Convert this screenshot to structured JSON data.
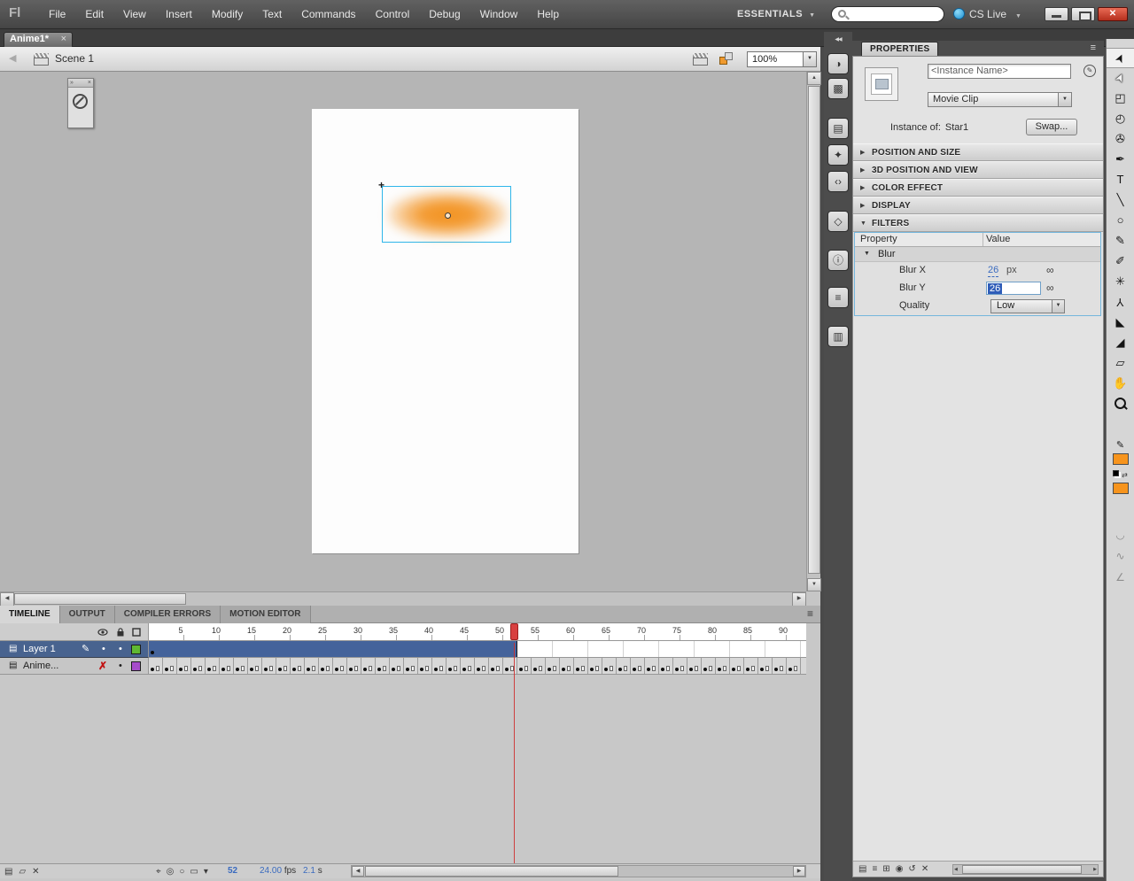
{
  "app": {
    "logo": "Fl"
  },
  "menubar": {
    "items": [
      "File",
      "Edit",
      "View",
      "Insert",
      "Modify",
      "Text",
      "Commands",
      "Control",
      "Debug",
      "Window",
      "Help"
    ],
    "workspace": "ESSENTIALS",
    "cs_live": "CS Live",
    "search_value": ""
  },
  "icons": {
    "close": "✕",
    "close_small": "×",
    "up": "▲",
    "down": "▼",
    "left": "◀",
    "right": "▶",
    "tri_right": "▶",
    "menu": "≡",
    "collapse_left": "◀◀",
    "chevrons_right": "»",
    "pencil": "✎",
    "dot": "•",
    "hidden_x": "✗",
    "crosshair": "+",
    "link": "∞",
    "swap_colors": "⇄",
    "layer": "▤"
  },
  "doc_tab": {
    "title": "Anime1*",
    "close_glyph": "×"
  },
  "edit_bar": {
    "scene_label": "Scene 1",
    "zoom_value": "100%"
  },
  "dock_icons": [
    {
      "name": "color",
      "glyph": "◑"
    },
    {
      "name": "swatches",
      "glyph": "▩"
    },
    {
      "name": "components",
      "glyph": "▤"
    },
    {
      "name": "motion-presets",
      "glyph": "✦"
    },
    {
      "name": "code-snippets",
      "glyph": "‹›"
    },
    {
      "name": "transform",
      "glyph": "◇"
    },
    {
      "name": "info",
      "glyph": "ⓘ"
    },
    {
      "name": "align",
      "glyph": "≡"
    },
    {
      "name": "library",
      "glyph": "▥"
    }
  ],
  "properties": {
    "tab": "PROPERTIES",
    "instance_name_placeholder": "<Instance Name>",
    "symbol_type": "Movie Clip",
    "instance_of_label": "Instance of:",
    "instance_of_value": "Star1",
    "swap_label": "Swap...",
    "sections": [
      {
        "label": "POSITION AND SIZE",
        "expanded": false
      },
      {
        "label": "3D POSITION AND VIEW",
        "expanded": false
      },
      {
        "label": "COLOR EFFECT",
        "expanded": false
      },
      {
        "label": "DISPLAY",
        "expanded": false
      },
      {
        "label": "FILTERS",
        "expanded": true
      }
    ],
    "filters": {
      "property_header": "Property",
      "value_header": "Value",
      "group_label": "Blur",
      "blur_x_label": "Blur X",
      "blur_x_value": "26",
      "blur_x_unit": "px",
      "blur_y_label": "Blur Y",
      "blur_y_value": "26",
      "quality_label": "Quality",
      "quality_value": "Low"
    },
    "filter_bar_icons": [
      {
        "name": "add-filter",
        "glyph": "▤"
      },
      {
        "name": "presets",
        "glyph": "≡"
      },
      {
        "name": "clipboard",
        "glyph": "⊞"
      },
      {
        "name": "enable-filter",
        "glyph": "◉"
      },
      {
        "name": "reset-filter",
        "glyph": "↺"
      },
      {
        "name": "delete-filter",
        "glyph": "✕"
      }
    ]
  },
  "timeline": {
    "tabs": [
      {
        "label": "TIMELINE",
        "active": true
      },
      {
        "label": "OUTPUT",
        "active": false
      },
      {
        "label": "COMPILER ERRORS",
        "active": false
      },
      {
        "label": "MOTION EDITOR",
        "active": false
      }
    ],
    "ruler_numbers": [
      5,
      10,
      15,
      20,
      25,
      30,
      35,
      40,
      45,
      50,
      55,
      60,
      65,
      70,
      75,
      80,
      85,
      90
    ],
    "layers": [
      {
        "name": "Layer 1",
        "selected": true,
        "editing": true,
        "outline_color": "#5fb832"
      },
      {
        "name": "Anime...",
        "selected": false,
        "hidden": true,
        "outline_color": "#a64ccb"
      }
    ],
    "frame_width": 8,
    "playhead_frame": 52,
    "layer1_filled_frames": 52,
    "anime_keyframe_pairs": 46,
    "current_frame": "52",
    "fps_value": "24.00",
    "fps_unit": "fps",
    "elapsed_value": "2.1",
    "elapsed_unit": "s",
    "onion_icons": [
      {
        "name": "center-frame",
        "glyph": "⌖"
      },
      {
        "name": "onion-skin",
        "glyph": "◎"
      },
      {
        "name": "onion-skin-outlines",
        "glyph": "○"
      },
      {
        "name": "edit-multiple-frames",
        "glyph": "▭"
      },
      {
        "name": "modify-markers",
        "glyph": "▾"
      }
    ],
    "layer_ops_icons": [
      {
        "name": "new-layer",
        "glyph": "▤"
      },
      {
        "name": "new-folder",
        "glyph": "▱"
      },
      {
        "name": "delete-layer",
        "glyph": "✕"
      }
    ]
  },
  "tools": [
    {
      "name": "selection",
      "glyph": "➤",
      "cls": "rot-up",
      "selected": true
    },
    {
      "name": "subselection",
      "glyph": "➤",
      "cls": "rot-up hollow"
    },
    {
      "name": "free-transform",
      "glyph": "◰"
    },
    {
      "name": "3d-rotation",
      "glyph": "◴"
    },
    {
      "name": "lasso",
      "glyph": "✇"
    },
    {
      "name": "pen",
      "glyph": "✒"
    },
    {
      "name": "text",
      "glyph": "T"
    },
    {
      "name": "line",
      "glyph": "╲"
    },
    {
      "name": "oval",
      "glyph": "○"
    },
    {
      "name": "pencil",
      "glyph": "✎"
    },
    {
      "name": "brush",
      "glyph": "✐"
    },
    {
      "name": "deco",
      "glyph": "✳"
    },
    {
      "name": "bone",
      "glyph": "Y",
      "cls": "flip"
    },
    {
      "name": "paint-bucket",
      "glyph": "◣"
    },
    {
      "name": "eyedropper",
      "glyph": "◢"
    },
    {
      "name": "eraser",
      "glyph": "▱"
    },
    {
      "name": "hand",
      "glyph": "✋"
    },
    {
      "name": "zoom",
      "glyph": "",
      "cls": "zoom-css"
    }
  ],
  "tool_options": [
    {
      "name": "snap-to-objects",
      "glyph": "◡"
    },
    {
      "name": "smooth",
      "glyph": "∿"
    },
    {
      "name": "straighten",
      "glyph": "∠"
    }
  ],
  "colors": {
    "fill_swatch": "#f7941d",
    "stroke_swatch": "#f7941d",
    "selection_outline": "#2fb6ea",
    "blob": "#f2911e",
    "playhead": "#d63a3a",
    "hot_text": "#3a6bbf",
    "layer_selected_bg": "#48638f"
  }
}
